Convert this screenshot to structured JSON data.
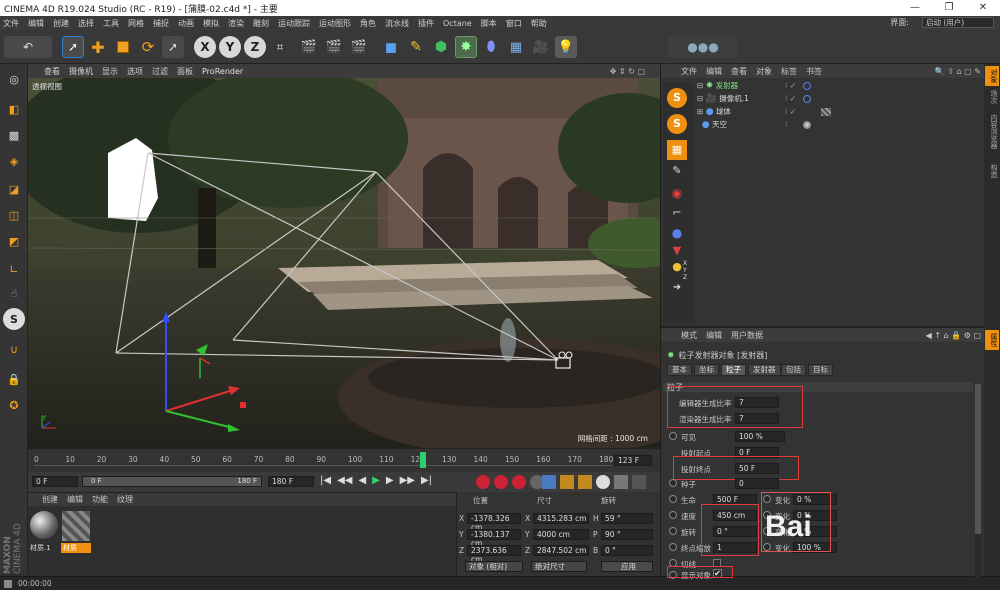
{
  "window": {
    "title": "CINEMA 4D R19.024 Studio (RC - R19) - [蒲膜-02.c4d *] - 主要",
    "minimize": "—",
    "restore": "❐",
    "close": "✕"
  },
  "menu": [
    "文件",
    "编辑",
    "创建",
    "选择",
    "工具",
    "网格",
    "捕捉",
    "动画",
    "模拟",
    "渲染",
    "雕刻",
    "运动跟踪",
    "运动图形",
    "角色",
    "流水线",
    "插件",
    "Octane",
    "脚本",
    "窗口",
    "帮助"
  ],
  "layout": {
    "label": "界面:",
    "value": "启动 (用户)"
  },
  "toolbar": {
    "x_label": "X",
    "y_label": "Y",
    "z_label": "Z"
  },
  "viewport": {
    "menu": [
      "查看",
      "摄像机",
      "显示",
      "选项",
      "过滤",
      "面板",
      "ProRender"
    ],
    "label": "透视视图",
    "grid_info": "网格间距 : 1000 cm"
  },
  "timeline": {
    "ticks": [
      "0",
      "10",
      "20",
      "30",
      "40",
      "50",
      "60",
      "70",
      "80",
      "90",
      "100",
      "110",
      "120",
      "130",
      "140",
      "150",
      "160",
      "170",
      "180"
    ],
    "current_frame": "123",
    "current_frame_field": "123 F",
    "current_frame_fraction": 0.683
  },
  "playbar": {
    "start": "0 F",
    "range_start": "0 F",
    "range_end": "180 F",
    "end": "180 F"
  },
  "materials": {
    "menu": [
      "创建",
      "编辑",
      "功能",
      "纹理"
    ],
    "items": [
      {
        "name": "材质.1"
      },
      {
        "name": "材质"
      }
    ]
  },
  "coords": {
    "headers": [
      "位置",
      "尺寸",
      "旋转"
    ],
    "rows": [
      {
        "axis": "X",
        "pos": "-1378.326 cm",
        "size_axis": "X",
        "size": "4315.283 cm",
        "rot_axis": "H",
        "rot": "59 °"
      },
      {
        "axis": "Y",
        "pos": "-1380.137 cm",
        "size_axis": "Y",
        "size": "4000 cm",
        "rot_axis": "P",
        "rot": "90 °"
      },
      {
        "axis": "Z",
        "pos": "2373.636 cm",
        "size_axis": "Z",
        "size": "2847.502 cm",
        "rot_axis": "B",
        "rot": "0 °"
      }
    ],
    "mode": "对象 (相对)",
    "size_mode": "绝对尺寸",
    "apply": "应用"
  },
  "status": {
    "time": "00:00:00"
  },
  "objects": {
    "menu": [
      "文件",
      "编辑",
      "查看",
      "对象",
      "标签",
      "书签"
    ],
    "items": [
      {
        "name": "发射器",
        "color": "#7fe07f"
      },
      {
        "name": "摄像机.1",
        "color": "#dcdcdc"
      },
      {
        "name": "球体",
        "color": "#dcdcdc"
      },
      {
        "name": "天空",
        "color": "#dcdcdc"
      }
    ]
  },
  "attributes": {
    "menu": [
      "模式",
      "编辑",
      "用户数据"
    ],
    "header": "粒子发射器对象 [发射器]",
    "tabs": [
      "基本",
      "坐标",
      "粒子",
      "发射器",
      "包括",
      "目标"
    ],
    "active_tab": "粒子",
    "section": "粒子",
    "fields": [
      {
        "label": "编辑器生成比率",
        "value": "7"
      },
      {
        "label": "渲染器生成比率",
        "value": "7"
      },
      {
        "label": "可见",
        "value": "100 %"
      },
      {
        "label": "投射起点",
        "value": "0 F"
      },
      {
        "label": "投射终点",
        "value": "50 F"
      },
      {
        "label": "种子",
        "value": "0"
      }
    ],
    "pairs": [
      {
        "label": "生命",
        "value": "500 F",
        "label2": "变化",
        "value2": "0 %"
      },
      {
        "label": "速度",
        "value": "450 cm",
        "label2": "变化",
        "value2": "0 %"
      },
      {
        "label": "旋转",
        "value": "0 °",
        "label2": "变化",
        "value2": "0 %"
      },
      {
        "label": "终点缩放",
        "value": "1",
        "label2": "变化",
        "value2": "100 %"
      }
    ],
    "tangent": "切线",
    "show_object": "显示对象",
    "show_object_check": "✔"
  },
  "right_strip": [
    "对象",
    "场次",
    "内容浏览器",
    "构造"
  ],
  "right_strip_attr": [
    "属性"
  ],
  "maxon": {
    "brand": "MAXON",
    "product": "CINEMA 4D"
  },
  "watermark": "Bai"
}
